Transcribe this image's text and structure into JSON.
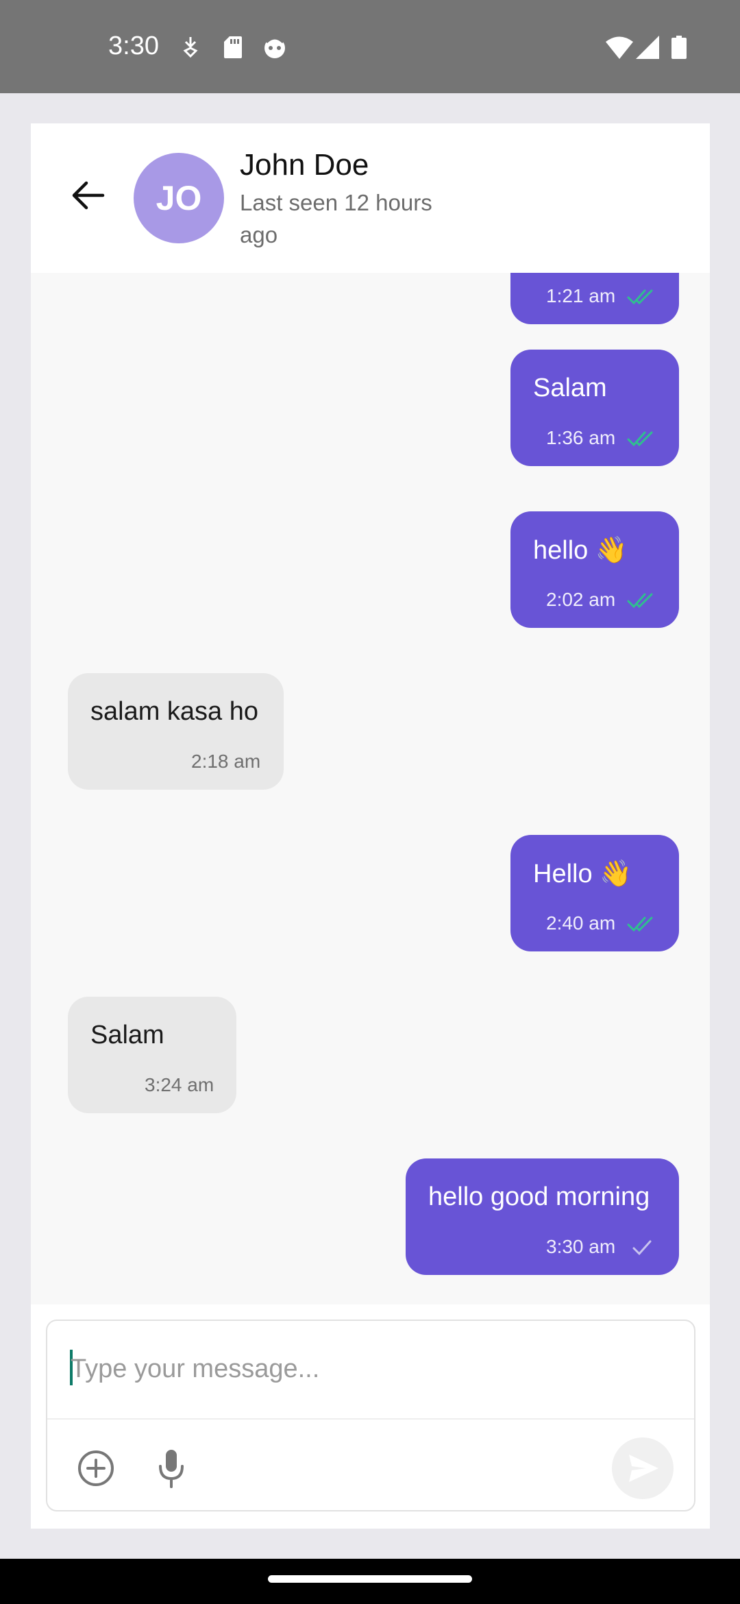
{
  "status_bar": {
    "time": "3:30",
    "left_icons": [
      "download-arrow-icon",
      "sd-card-icon",
      "face-icon"
    ],
    "right_icons": [
      "wifi-icon",
      "cell-signal-icon",
      "battery-icon"
    ]
  },
  "header": {
    "avatar_initials": "JO",
    "avatar_color": "#a899e6",
    "name": "John Doe",
    "status": "Last seen 12 hours ago"
  },
  "messages": [
    {
      "direction": "out",
      "text": "",
      "time": "1:21 am",
      "status": "read"
    },
    {
      "direction": "out",
      "text": "Salam",
      "time": "1:36 am",
      "status": "read"
    },
    {
      "direction": "out",
      "text": "hello 👋",
      "time": "2:02 am",
      "status": "read"
    },
    {
      "direction": "in",
      "text": "salam kasa ho",
      "time": "2:18 am"
    },
    {
      "direction": "out",
      "text": "Hello 👋",
      "time": "2:40 am",
      "status": "read"
    },
    {
      "direction": "in",
      "text": "Salam",
      "time": "3:24 am"
    },
    {
      "direction": "out",
      "text": "hello good morning",
      "time": "3:30 am",
      "status": "sent"
    }
  ],
  "composer": {
    "placeholder": "Type your message...",
    "value": ""
  },
  "colors": {
    "outgoing_bubble": "#6854d6",
    "incoming_bubble": "#e8e8e8",
    "read_tick": "#2fbf8f",
    "sent_tick": "#c9c4ef"
  }
}
